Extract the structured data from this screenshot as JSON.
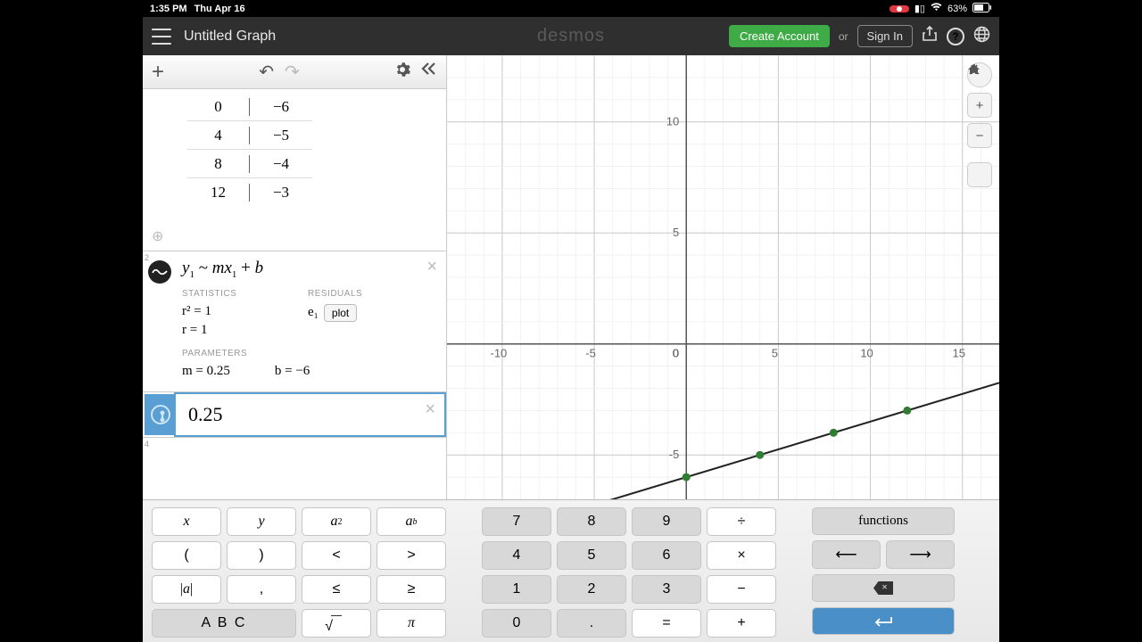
{
  "status": {
    "time": "1:35 PM",
    "date": "Thu Apr 16",
    "battery": "63%"
  },
  "header": {
    "title": "Untitled Graph",
    "logo": "desmos",
    "create": "Create Account",
    "or": "or",
    "signin": "Sign In"
  },
  "table": {
    "rows": [
      {
        "x": "0",
        "y": "−6"
      },
      {
        "x": "4",
        "y": "−5"
      },
      {
        "x": "8",
        "y": "−4"
      },
      {
        "x": "12",
        "y": "−3"
      }
    ]
  },
  "regression": {
    "formula_parts": {
      "y": "y",
      "sub1": "1",
      "tilde": " ~ ",
      "m": "m",
      "x": "x",
      "plus": " + ",
      "b": "b"
    },
    "stats_h": "STATISTICS",
    "r2": "r² = 1",
    "r": "r = 1",
    "resid_h": "RESIDUALS",
    "e1": "e₁",
    "plot": "plot",
    "params_h": "PARAMETERS",
    "m": "m = 0.25",
    "b": "b = −6"
  },
  "active_expr": "0.25",
  "chart_data": {
    "type": "scatter",
    "x": [
      0,
      4,
      8,
      12
    ],
    "y": [
      -6,
      -5,
      -4,
      -3
    ],
    "fit": {
      "m": 0.25,
      "b": -6
    },
    "xlim": [
      -13,
      17
    ],
    "ylim": [
      -7,
      13
    ],
    "xticks": [
      -10,
      -5,
      0,
      5,
      10,
      15
    ],
    "yticks": [
      -5,
      5,
      10
    ]
  },
  "kbd": {
    "g1": [
      "x",
      "y",
      "a²",
      "aᵇ",
      "(",
      ")",
      "<",
      ">",
      "|a|",
      ",",
      "≤",
      "≥"
    ],
    "g1_abc": "A B C",
    "g1_sqrt": "√",
    "g1_pi": "π",
    "g2": [
      "7",
      "8",
      "9",
      "÷",
      "4",
      "5",
      "6",
      "×",
      "1",
      "2",
      "3",
      "−",
      "0",
      ".",
      "=",
      "+"
    ],
    "functions": "functions",
    "left": "⟵",
    "right": "⟶",
    "enter": "↵"
  }
}
